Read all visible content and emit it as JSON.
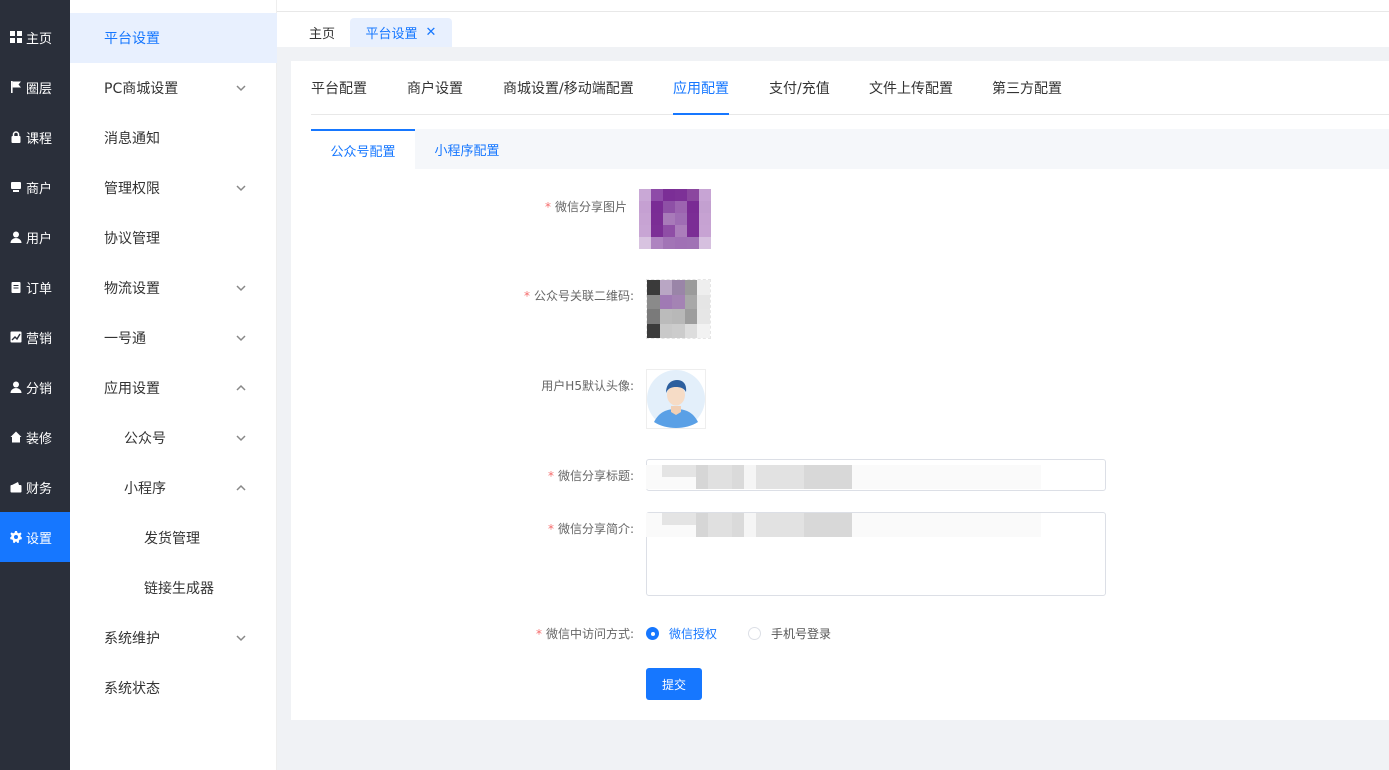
{
  "rail": {
    "items": [
      {
        "label": "主页",
        "icon": "grid-icon"
      },
      {
        "label": "圈层",
        "icon": "flag-icon"
      },
      {
        "label": "课程",
        "icon": "lock-icon"
      },
      {
        "label": "商户",
        "icon": "shop-icon"
      },
      {
        "label": "用户",
        "icon": "user-icon"
      },
      {
        "label": "订单",
        "icon": "clipboard-icon"
      },
      {
        "label": "营销",
        "icon": "chart-icon"
      },
      {
        "label": "分销",
        "icon": "person-icon"
      },
      {
        "label": "装修",
        "icon": "home-icon"
      },
      {
        "label": "财务",
        "icon": "wallet-icon"
      },
      {
        "label": "设置",
        "icon": "gear-icon"
      }
    ],
    "active_index": 10
  },
  "submenu": {
    "items": [
      {
        "label": "平台设置",
        "chevron": "",
        "active": true
      },
      {
        "label": "PC商城设置",
        "chevron": "down"
      },
      {
        "label": "消息通知",
        "chevron": ""
      },
      {
        "label": "管理权限",
        "chevron": "down"
      },
      {
        "label": "协议管理",
        "chevron": ""
      },
      {
        "label": "物流设置",
        "chevron": "down"
      },
      {
        "label": "一号通",
        "chevron": "down"
      },
      {
        "label": "应用设置",
        "chevron": "up"
      },
      {
        "label": "公众号",
        "chevron": "down"
      },
      {
        "label": "小程序",
        "chevron": "up"
      },
      {
        "label": "发货管理",
        "chevron": ""
      },
      {
        "label": "链接生成器",
        "chevron": ""
      },
      {
        "label": "系统维护",
        "chevron": "down"
      },
      {
        "label": "系统状态",
        "chevron": ""
      }
    ]
  },
  "page_tabs": {
    "home": "主页",
    "current": "平台设置",
    "close": "✕"
  },
  "config_tabs": {
    "items": [
      "平台配置",
      "商户设置",
      "商城设置/移动端配置",
      "应用配置",
      "支付/充值",
      "文件上传配置",
      "第三方配置"
    ],
    "active_index": 3
  },
  "sub_tabs": {
    "items": [
      "公众号配置",
      "小程序配置"
    ],
    "active_index": 0
  },
  "form": {
    "share_image_label": "微信分享图片",
    "qrcode_label": "公众号关联二维码:",
    "avatar_label": "用户H5默认头像:",
    "share_title_label": "微信分享标题:",
    "share_desc_label": "微信分享简介:",
    "access_label": "微信中访问方式:",
    "access_options": [
      "微信授权",
      "手机号登录"
    ],
    "access_selected": 0,
    "submit_label": "提交"
  },
  "colors": {
    "accent": "#1677ff",
    "rail_bg": "#2a2f3a",
    "required": "#f56c6c"
  }
}
